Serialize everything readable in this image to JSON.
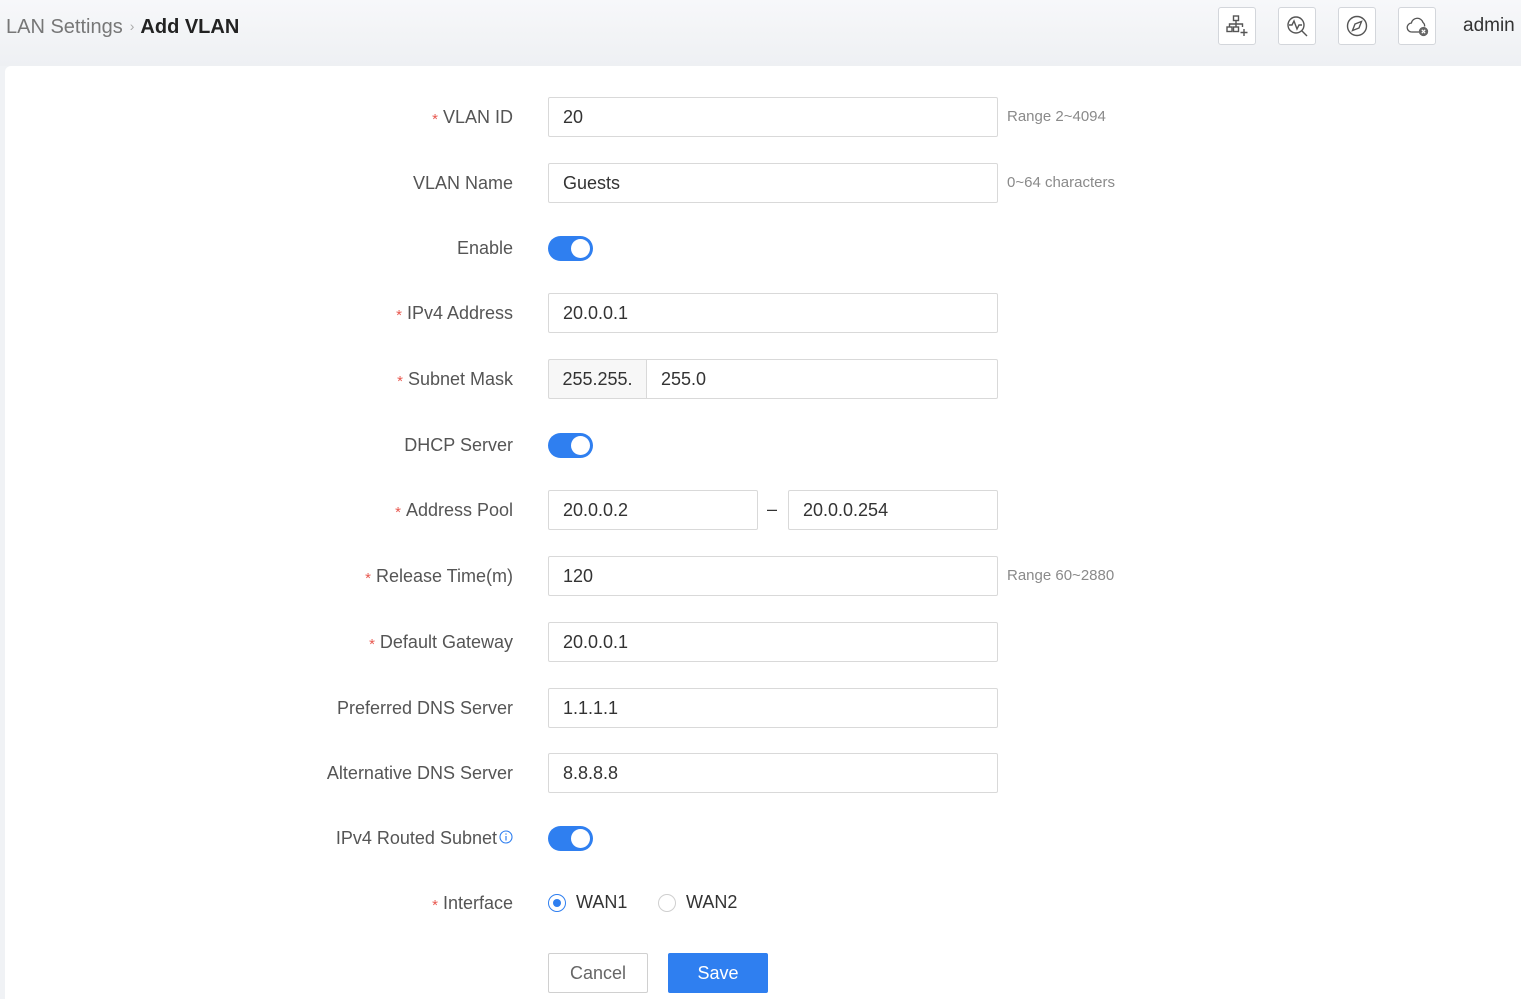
{
  "breadcrumb": {
    "parent": "LAN Settings",
    "separator": "›",
    "current": "Add VLAN"
  },
  "header": {
    "icons": [
      "network-add-icon",
      "diagnostics-icon",
      "compass-icon",
      "cloud-disconnected-icon"
    ],
    "user": "admin"
  },
  "form": {
    "vlan_id": {
      "label": "VLAN ID",
      "required": true,
      "value": "20",
      "hint": "Range 2~4094"
    },
    "vlan_name": {
      "label": "VLAN Name",
      "required": false,
      "value": "Guests",
      "hint": "0~64 characters"
    },
    "enable": {
      "label": "Enable",
      "on": true
    },
    "ipv4_address": {
      "label": "IPv4 Address",
      "required": true,
      "value": "20.0.0.1"
    },
    "subnet_mask": {
      "label": "Subnet Mask",
      "required": true,
      "prefix": "255.255.",
      "value": "255.0"
    },
    "dhcp_server": {
      "label": "DHCP Server",
      "on": true
    },
    "address_pool": {
      "label": "Address Pool",
      "required": true,
      "start": "20.0.0.2",
      "separator": "–",
      "end": "20.0.0.254"
    },
    "release_time": {
      "label": "Release Time(m)",
      "required": true,
      "value": "120",
      "hint": "Range 60~2880"
    },
    "default_gateway": {
      "label": "Default Gateway",
      "required": true,
      "value": "20.0.0.1"
    },
    "preferred_dns": {
      "label": "Preferred DNS Server",
      "required": false,
      "value": "1.1.1.1"
    },
    "alternative_dns": {
      "label": "Alternative DNS Server",
      "required": false,
      "value": "8.8.8.8"
    },
    "ipv4_routed_subnet": {
      "label": "IPv4 Routed Subnet",
      "on": true
    },
    "interface": {
      "label": "Interface",
      "required": true,
      "options": [
        "WAN1",
        "WAN2"
      ],
      "selected": "WAN1"
    }
  },
  "buttons": {
    "cancel": "Cancel",
    "save": "Save"
  },
  "required_mark": "*",
  "colors": {
    "primary": "#2f7ff0",
    "required": "#e8584f"
  }
}
